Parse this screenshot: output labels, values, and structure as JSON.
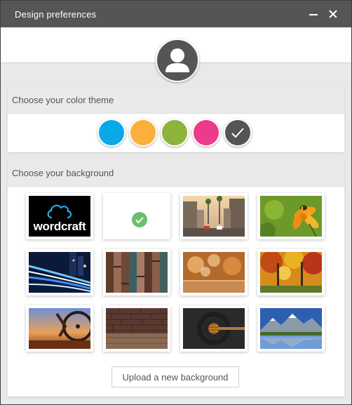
{
  "window": {
    "title": "Design preferences",
    "minimize_icon": "minimize-icon",
    "close_icon": "close-icon"
  },
  "profile": {
    "avatar_icon": "user-icon"
  },
  "theme": {
    "heading": "Choose your color theme",
    "swatches": [
      {
        "name": "blue",
        "color": "#0aa8e8",
        "selected": false
      },
      {
        "name": "orange",
        "color": "#fbb03b",
        "selected": false
      },
      {
        "name": "green",
        "color": "#8db33a",
        "selected": false
      },
      {
        "name": "pink",
        "color": "#ec3a8d",
        "selected": false
      },
      {
        "name": "dark-gray",
        "color": "#555555",
        "selected": true
      }
    ]
  },
  "background": {
    "heading": "Choose your background",
    "tiles": [
      {
        "name": "wordcraft-logo",
        "label": "wordcraft",
        "selected": false
      },
      {
        "name": "blank-white",
        "label": "",
        "selected": true
      },
      {
        "name": "city-street",
        "label": "",
        "selected": false
      },
      {
        "name": "flower-bee",
        "label": "",
        "selected": false
      },
      {
        "name": "light-trails",
        "label": "",
        "selected": false
      },
      {
        "name": "wood-planks",
        "label": "",
        "selected": false
      },
      {
        "name": "bokeh-table",
        "label": "",
        "selected": false
      },
      {
        "name": "autumn-forest",
        "label": "",
        "selected": false
      },
      {
        "name": "cyclist",
        "label": "",
        "selected": false
      },
      {
        "name": "brick-wall",
        "label": "",
        "selected": false
      },
      {
        "name": "honey-dipper",
        "label": "",
        "selected": false
      },
      {
        "name": "mountain-lake",
        "label": "",
        "selected": false
      }
    ],
    "upload_label": "Upload a new background"
  },
  "colors": {
    "titlebar": "#555555",
    "check": "#6bbf6b"
  }
}
